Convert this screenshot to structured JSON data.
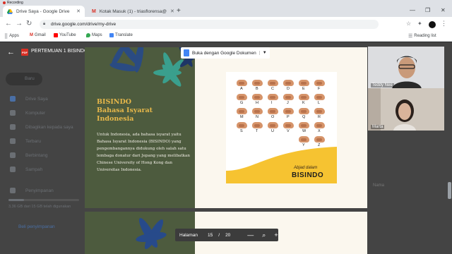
{
  "recording": "Recording",
  "tabs": [
    {
      "label": "Drive Saya - Google Drive"
    },
    {
      "label": "Kotak Masuk (1) - triasflorensa@"
    }
  ],
  "address": {
    "url": "drive.google.com/drive/my-drive"
  },
  "bookmarks": [
    "Apps",
    "Gmail",
    "YouTube",
    "Maps",
    "Translate"
  ],
  "reading_list": "Reading list",
  "drive": {
    "new_label": "Baru",
    "sidebar": [
      "Drive Saya",
      "Komputer",
      "Dibagikan kepada saya",
      "Terbaru",
      "Berbintang",
      "Sampah",
      "Penyimpanan"
    ],
    "storage_text": "3,36 GB dari 15 GB telah digunakan",
    "storage_used_fraction": 0.224,
    "buy_storage": "Beli penyimpanan",
    "right_col_header": "Nama"
  },
  "viewer": {
    "doc_title": "PERTEMUAN 1 BISINDO",
    "open_with": "Buka dengan Google Dokumen",
    "page_label": "Halaman",
    "current_page": "15",
    "page_sep": "/",
    "total_pages": "20"
  },
  "slide": {
    "title_lines": [
      "BISINDO",
      "Bahasa Isyarat",
      "Indonesia"
    ],
    "body": "Untuk Indonesia, ada bahasa isyarat yaitu Bahasa Isyarat Indonesia (BISINDO) yang pengembangannya didukung oleh salah satu lembaga donatur dari Jepang yang melibatkan Chinese University of Hong Kong dan Universitas Indonesia.",
    "alphabet": [
      "A",
      "B",
      "C",
      "D",
      "E",
      "F",
      "G",
      "H",
      "I",
      "J",
      "K",
      "L",
      "M",
      "N",
      "O",
      "P",
      "Q",
      "R",
      "S",
      "T",
      "U",
      "V",
      "W",
      "X",
      "Y",
      "Z"
    ],
    "caption_small": "Abjad dalam",
    "caption_big": "BISINDO"
  },
  "participants": [
    "Teddy Nee",
    "Marta"
  ]
}
